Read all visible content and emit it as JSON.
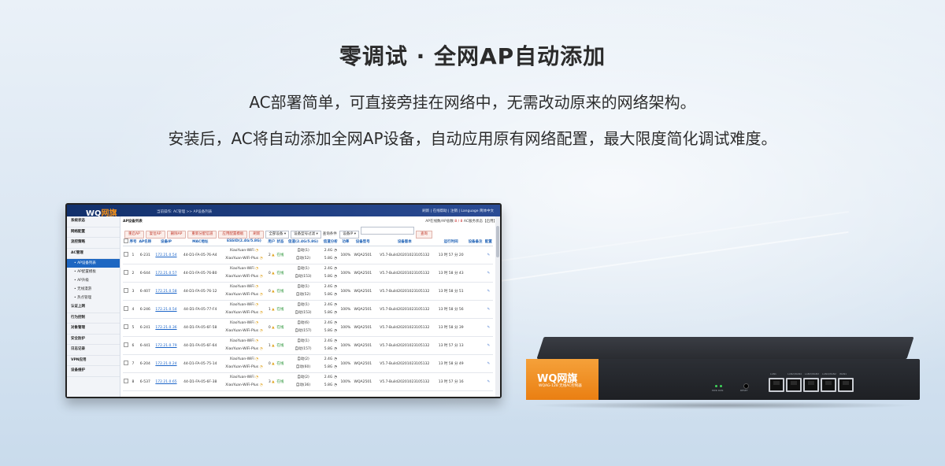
{
  "headline": "零调试 · 全网AP自动添加",
  "subtitle_1": "AC部署简单，可直接旁挂在网络中，无需改动原来的网络架构。",
  "subtitle_2": "安装后，AC将自动添加全网AP设备，自动应用原有网络配置，最大限度简化调试难度。",
  "app": {
    "logo_wq": "WQ",
    "logo_brand": "网旗",
    "breadcrumb": "当前操作: AC管理 >> AP设备列表",
    "top_links": "刷新 | 在线帮助 | 注销 | Language 简体中文",
    "page_title": "AP设备列表",
    "status_prefix": "AP在线数/AP总数:",
    "status_count": "8 / 8",
    "status_suffix": "AC服务状态【启用】",
    "sidebar": [
      {
        "label": "系统状态",
        "type": "item"
      },
      {
        "label": "网络配置",
        "type": "item"
      },
      {
        "label": "流控策略",
        "type": "item"
      },
      {
        "label": "AC管理",
        "type": "item"
      },
      {
        "label": "AP设备列表",
        "type": "sub",
        "active": true
      },
      {
        "label": "AP配置模板",
        "type": "sub"
      },
      {
        "label": "AP升级",
        "type": "sub"
      },
      {
        "label": "无线漫游",
        "type": "sub"
      },
      {
        "label": "热点管理",
        "type": "sub"
      },
      {
        "label": "认证上网",
        "type": "item"
      },
      {
        "label": "行为控制",
        "type": "item"
      },
      {
        "label": "对象管理",
        "type": "item"
      },
      {
        "label": "安全防护",
        "type": "item"
      },
      {
        "label": "日志记录",
        "type": "item"
      },
      {
        "label": "VPN应用",
        "type": "item"
      },
      {
        "label": "设备维护",
        "type": "item"
      }
    ],
    "toolbar": {
      "buttons": [
        "重启AP",
        "复位AP",
        "删除AP",
        "重新分配信道",
        "应用配置模板",
        "刷新"
      ],
      "select_all": "全部设备",
      "select_model": "设备型号过滤",
      "query_label": "查询条件",
      "select_field": "设备IP",
      "query_button": "查询"
    },
    "columns": [
      "序号",
      "AP名称",
      "设备IP",
      "MAC地址",
      "ESSID(2.4G/5.8G)",
      "用户",
      "状态",
      "信道(2.4G/5.8G)",
      "信道分析",
      "功率",
      "设备型号",
      "设备版本",
      "运行时间",
      "设备备注",
      "配置"
    ],
    "rows": [
      {
        "no": "1",
        "name": "6-231",
        "ip": "172.21.0.54",
        "mac": "44-D1-FA-05-76-A4",
        "users": "2",
        "ch1": "自动(1)",
        "ch2": "自动(52)",
        "uptime": "13 时 57 分 20"
      },
      {
        "no": "2",
        "name": "6-644",
        "ip": "172.21.0.57",
        "mac": "44-D1-FA-05-76-B0",
        "users": "0",
        "ch1": "自动(1)",
        "ch2": "自动(153)",
        "uptime": "13 时 58 分 43"
      },
      {
        "no": "3",
        "name": "6-407",
        "ip": "172.21.0.58",
        "mac": "44-D1-FA-05-76-12",
        "users": "0",
        "ch1": "自动(1)",
        "ch2": "自动(52)",
        "uptime": "13 时 58 分 51"
      },
      {
        "no": "4",
        "name": "6-246",
        "ip": "172.21.0.54",
        "mac": "44-D1-FA-05-77-F4",
        "users": "1",
        "ch1": "自动(1)",
        "ch2": "自动(153)",
        "uptime": "13 时 58 分 56"
      },
      {
        "no": "5",
        "name": "6-241",
        "ip": "172.21.0.36",
        "mac": "44-D1-FA-05-6F-58",
        "users": "0",
        "ch1": "自动(6)",
        "ch2": "自动(157)",
        "uptime": "13 时 58 分 39"
      },
      {
        "no": "6",
        "name": "6-441",
        "ip": "172.21.0.79",
        "mac": "44-D1-FA-05-6F-64",
        "users": "1",
        "ch1": "自动(1)",
        "ch2": "自动(157)",
        "uptime": "13 时 57 分 13"
      },
      {
        "no": "7",
        "name": "6-204",
        "ip": "172.21.0.24",
        "mac": "44-D1-FA-05-75-14",
        "users": "0",
        "ch1": "自动(2)",
        "ch2": "自动(60)",
        "uptime": "13 时 58 分 49"
      },
      {
        "no": "8",
        "name": "6-537",
        "ip": "172.21.0.65",
        "mac": "44-D1-FA-05-6F-38",
        "users": "3",
        "ch1": "自动(2)",
        "ch2": "自动(36)",
        "uptime": "13 时 57 分 16"
      }
    ],
    "common": {
      "essid_1": "XiaoYuan-WiFi",
      "essid_2": "XiaoYuan-WiFi-Plus",
      "status": "在线",
      "band_1": "2.4G",
      "band_2": "5.8G",
      "power": "100%",
      "model": "WQA2501",
      "version": "V5.7-Build20201023105132"
    }
  },
  "device": {
    "logo_wq": "WQ",
    "logo_brand": "网旗",
    "model_text": "WQAG-128 无线AC控制器",
    "led_label": "PWR RUN",
    "reset_label": "RESET",
    "port_labels": [
      "LAN1",
      "LAN2/WAN4",
      "LAN3/WAN3",
      "LAN4/WAN2",
      "WAN1"
    ]
  },
  "colors": {
    "accent": "#f39019",
    "nav": "#12306b",
    "link": "#1a64c8",
    "online": "#1f8f2e"
  }
}
